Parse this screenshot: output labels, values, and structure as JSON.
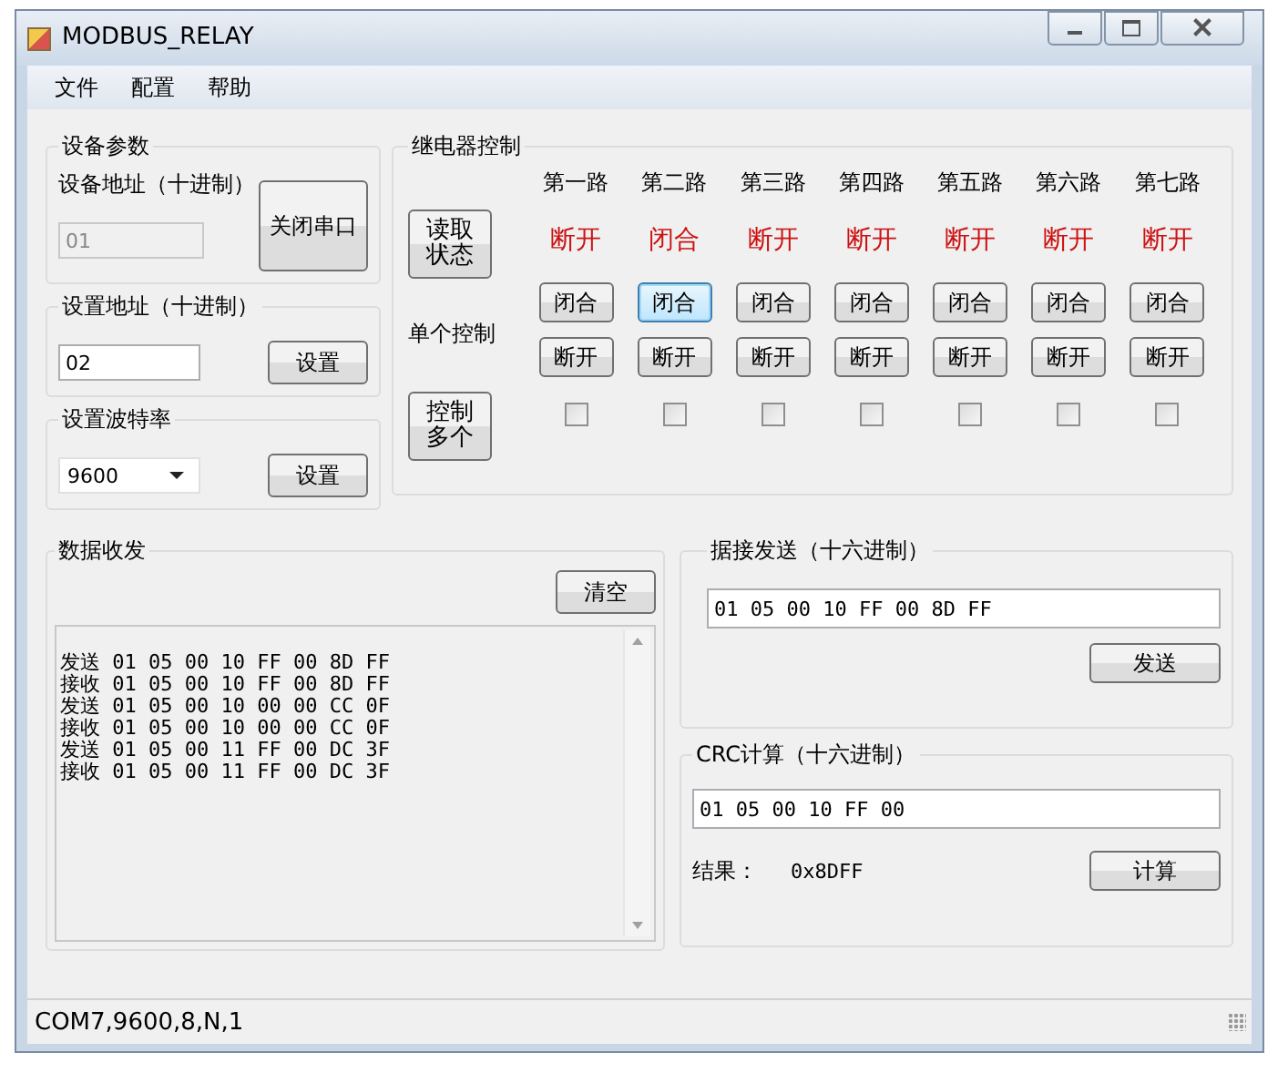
{
  "window": {
    "title": "MODBUS_RELAY"
  },
  "menu": [
    {
      "label": "文件"
    },
    {
      "label": "配置"
    },
    {
      "label": "帮助"
    }
  ],
  "device_params": {
    "title": "设备参数",
    "address_label": "设备地址（十进制）",
    "address_value": "01",
    "address_disabled": true,
    "close_port_button": "关闭串口"
  },
  "set_address": {
    "title": "设置地址（十进制）",
    "value": "02",
    "button": "设置"
  },
  "baud_rate": {
    "title": "设置波特率",
    "value": "9600",
    "button": "设置"
  },
  "relay_control": {
    "title": "继电器控制",
    "read_button": "读取状态",
    "single_label": "单个控制",
    "multi_button": "控制多个",
    "channels": [
      {
        "name": "第一路",
        "status": "断开",
        "close_button": "闭合",
        "open_button": "断开",
        "focused": false,
        "checked": false
      },
      {
        "name": "第二路",
        "status": "闭合",
        "close_button": "闭合",
        "open_button": "断开",
        "focused": true,
        "checked": false
      },
      {
        "name": "第三路",
        "status": "断开",
        "close_button": "闭合",
        "open_button": "断开",
        "focused": false,
        "checked": false
      },
      {
        "name": "第四路",
        "status": "断开",
        "close_button": "闭合",
        "open_button": "断开",
        "focused": false,
        "checked": false
      },
      {
        "name": "第五路",
        "status": "断开",
        "close_button": "闭合",
        "open_button": "断开",
        "focused": false,
        "checked": false
      },
      {
        "name": "第六路",
        "status": "断开",
        "close_button": "闭合",
        "open_button": "断开",
        "focused": false,
        "checked": false
      },
      {
        "name": "第七路",
        "status": "断开",
        "close_button": "闭合",
        "open_button": "断开",
        "focused": false,
        "checked": false
      }
    ]
  },
  "data_log": {
    "title": "数据收发",
    "clear_button": "清空",
    "lines": [
      "发送 01 05 00 10 FF 00 8D FF",
      "接收 01 05 00 10 FF 00 8D FF",
      "发送 01 05 00 10 00 00 CC 0F",
      "接收 01 05 00 10 00 00 CC 0F",
      "发送 01 05 00 11 FF 00 DC 3F",
      "接收 01 05 00 11 FF 00 DC 3F"
    ]
  },
  "send": {
    "title": "据接发送（十六进制）",
    "value": "01 05 00 10 FF 00 8D FF",
    "button": "发送"
  },
  "crc": {
    "title": "CRC计算（十六进制）",
    "value": "01 05 00 10 FF 00",
    "result_label": "结果：",
    "result_value": "0x8DFF",
    "button": "计算"
  },
  "status_bar": {
    "text": "COM7,9600,8,N,1"
  }
}
